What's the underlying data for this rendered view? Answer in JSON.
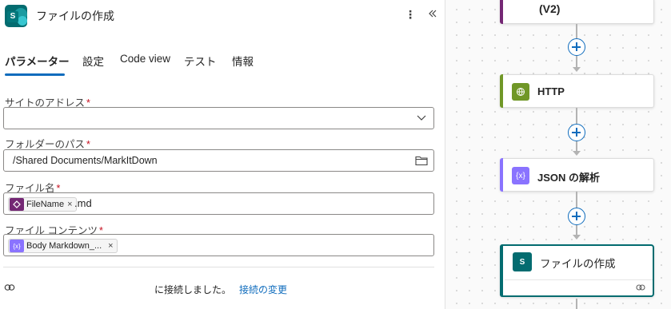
{
  "panel": {
    "title": "ファイルの作成",
    "icon": "sharepoint-icon",
    "more_icon": "more-vertical-icon",
    "collapse_icon": "double-chevron-left-icon"
  },
  "tabs": [
    {
      "label": "パラメーター",
      "active": true
    },
    {
      "label": "設定"
    },
    {
      "label": "Code view"
    },
    {
      "label": "テスト"
    },
    {
      "label": "情報"
    }
  ],
  "fields": {
    "site": {
      "label": "サイトのアドレス",
      "value": ""
    },
    "folder": {
      "label": "フォルダーのパス",
      "value": "/Shared Documents/MarkItDown"
    },
    "filename": {
      "label": "ファイル名",
      "token": "FileName",
      "token_close": "×",
      "suffix": ".md"
    },
    "content": {
      "label": "ファイル コンテンツ",
      "token": "Body Markdown_...",
      "token_close": "×"
    }
  },
  "required_mark": "*",
  "connection": {
    "text": "に接続しました。",
    "link": "接続の変更"
  },
  "canvas": {
    "nodes": [
      {
        "label": "(V2)",
        "accent": "#742774"
      },
      {
        "label": "HTTP",
        "accent": "#709727"
      },
      {
        "label": "JSON の解析",
        "accent": "#8a73ff"
      },
      {
        "label": "ファイルの作成",
        "accent": "#036c70"
      }
    ]
  },
  "colors": {
    "accent": "#0f6cbd",
    "sharepoint": "#036c70"
  }
}
